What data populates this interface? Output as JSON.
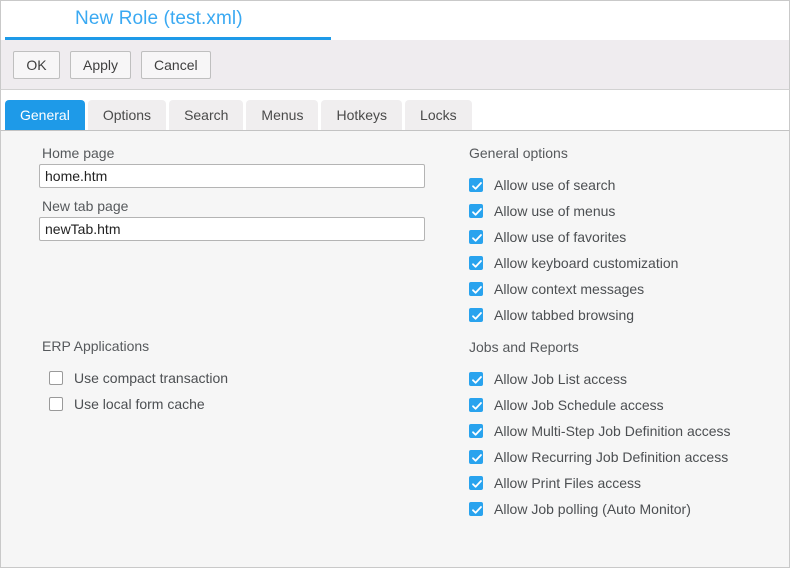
{
  "window": {
    "title": "New Role (test.xml)",
    "accent_color": "#1e9ae8",
    "title_color": "#3aa9f2"
  },
  "toolbar": {
    "ok_label": "OK",
    "apply_label": "Apply",
    "cancel_label": "Cancel"
  },
  "tabs": [
    {
      "label": "General",
      "active": true
    },
    {
      "label": "Options",
      "active": false
    },
    {
      "label": "Search",
      "active": false
    },
    {
      "label": "Menus",
      "active": false
    },
    {
      "label": "Hotkeys",
      "active": false
    },
    {
      "label": "Locks",
      "active": false
    }
  ],
  "general_tab": {
    "home_page": {
      "label": "Home page",
      "value": "home.htm"
    },
    "new_tab_page": {
      "label": "New tab page",
      "value": "newTab.htm"
    },
    "erp_applications": {
      "title": "ERP Applications",
      "items": [
        {
          "label": "Use compact transaction",
          "checked": false
        },
        {
          "label": "Use local form cache",
          "checked": false
        }
      ]
    },
    "general_options": {
      "title": "General options",
      "items": [
        {
          "label": "Allow use of search",
          "checked": true
        },
        {
          "label": "Allow use of menus",
          "checked": true
        },
        {
          "label": "Allow use of favorites",
          "checked": true
        },
        {
          "label": "Allow keyboard customization",
          "checked": true
        },
        {
          "label": "Allow context messages",
          "checked": true
        },
        {
          "label": "Allow tabbed browsing",
          "checked": true
        }
      ]
    },
    "jobs_and_reports": {
      "title": "Jobs and Reports",
      "items": [
        {
          "label": "Allow Job List access",
          "checked": true
        },
        {
          "label": "Allow Job Schedule access",
          "checked": true
        },
        {
          "label": "Allow Multi-Step Job Definition access",
          "checked": true
        },
        {
          "label": "Allow Recurring Job Definition access",
          "checked": true
        },
        {
          "label": "Allow Print Files access",
          "checked": true
        },
        {
          "label": "Allow Job polling (Auto Monitor)",
          "checked": true
        }
      ]
    }
  }
}
